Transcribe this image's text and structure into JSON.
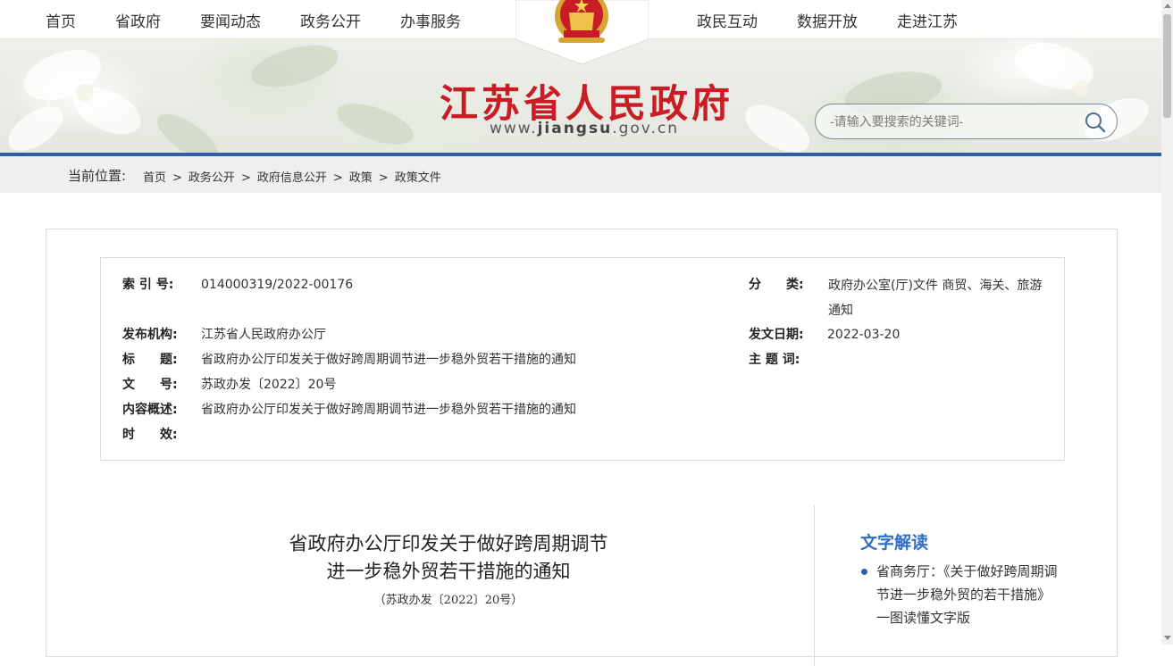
{
  "nav": {
    "left": [
      "首页",
      "省政府",
      "要闻动态",
      "政务公开",
      "办事服务"
    ],
    "right": [
      "政民互动",
      "数据开放",
      "走进江苏"
    ]
  },
  "banner": {
    "title": "江苏省人民政府",
    "url_prefix": "www.",
    "url_brand": "jiangsu",
    "url_suffix": ".gov.cn"
  },
  "search": {
    "placeholder": "-请输入要搜索的关键词-"
  },
  "breadcrumb": {
    "label": "当前位置:",
    "items": [
      "首页",
      "政务公开",
      "政府信息公开",
      "政策",
      "政策文件"
    ],
    "separator": ">"
  },
  "meta": {
    "index_label": "索 引 号:",
    "index_value": "014000319/2022-00176",
    "category_label": "分　　类:",
    "category_value": "政府办公室(厅)文件 商贸、海关、旅游 通知",
    "publisher_label": "发布机构:",
    "publisher_value": "江苏省人民政府办公厅",
    "date_label": "发文日期:",
    "date_value": "2022-03-20",
    "title_label": "标　　题:",
    "title_value": "省政府办公厅印发关于做好跨周期调节进一步稳外贸若干措施的通知",
    "keywords_label": "主 题 词:",
    "docno_label": "文　　号:",
    "docno_value": "苏政办发〔2022〕20号",
    "summary_label": "内容概述:",
    "summary_value": "省政府办公厅印发关于做好跨周期调节进一步稳外贸若干措施的通知",
    "validity_label": "时　　效:"
  },
  "document": {
    "title_line1": "省政府办公厅印发关于做好跨周期调节",
    "title_line2": "进一步稳外贸若干措施的通知",
    "number": "（苏政办发〔2022〕20号）"
  },
  "sidebar": {
    "heading": "文字解读",
    "link": "省商务厅：《关于做好跨周期调节进一步稳外贸的若干措施》一图读懂文字版"
  },
  "colors": {
    "brand_red": "#c81d25",
    "accent_blue": "#2f5ea8",
    "link_blue": "#2f6fc4"
  }
}
